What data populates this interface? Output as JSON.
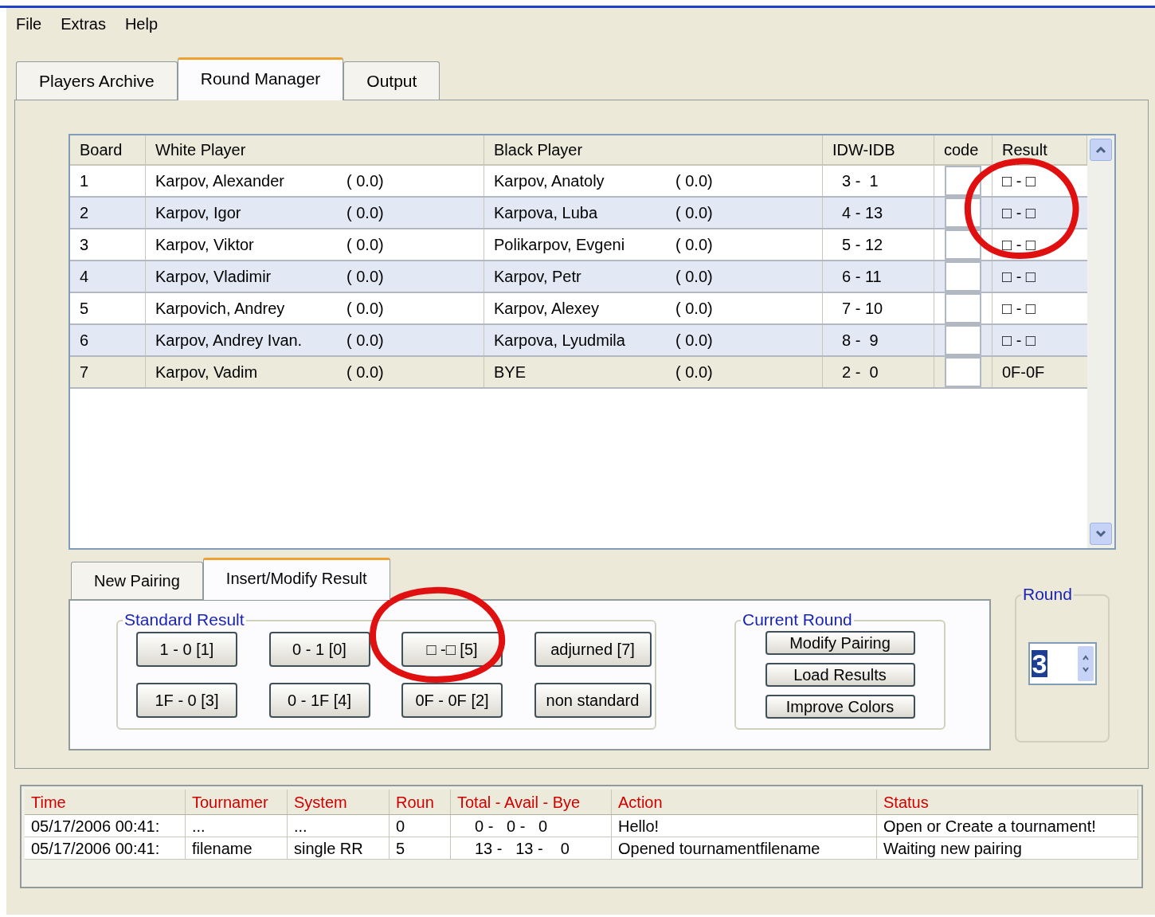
{
  "menu": [
    "File",
    "Extras",
    "Help"
  ],
  "tabs": [
    {
      "label": "Players Archive",
      "selected": false
    },
    {
      "label": "Round Manager",
      "selected": true
    },
    {
      "label": "Output",
      "selected": false
    }
  ],
  "pairings": {
    "columns": [
      "Board",
      "White Player",
      "Black Player",
      "IDW-IDB",
      "code",
      "Result"
    ],
    "rows": [
      {
        "board": "1",
        "white": "Karpov, Alexander",
        "white_score": "( 0.0)",
        "black": "Karpov, Anatoly",
        "black_score": "( 0.0)",
        "ids": "3 -  1",
        "result": "□ - □",
        "selected": false
      },
      {
        "board": "2",
        "white": "Karpov, Igor",
        "white_score": "( 0.0)",
        "black": "Karpova, Luba",
        "black_score": "( 0.0)",
        "ids": "4 - 13",
        "result": "□ - □",
        "selected": false
      },
      {
        "board": "3",
        "white": "Karpov, Viktor",
        "white_score": "( 0.0)",
        "black": "Polikarpov, Evgeni",
        "black_score": "( 0.0)",
        "ids": "5 - 12",
        "result": "□ - □",
        "selected": false
      },
      {
        "board": "4",
        "white": "Karpov, Vladimir",
        "white_score": "( 0.0)",
        "black": "Karpov, Petr",
        "black_score": "( 0.0)",
        "ids": "6 - 11",
        "result": "□ - □",
        "selected": false
      },
      {
        "board": "5",
        "white": "Karpovich, Andrey",
        "white_score": "( 0.0)",
        "black": "Karpov, Alexey",
        "black_score": "( 0.0)",
        "ids": "7 - 10",
        "result": "□ - □",
        "selected": false
      },
      {
        "board": "6",
        "white": "Karpov, Andrey Ivan.",
        "white_score": "( 0.0)",
        "black": "Karpova, Lyudmila",
        "black_score": "( 0.0)",
        "ids": "8 -  9",
        "result": "□ - □",
        "selected": false
      },
      {
        "board": "7",
        "white": "Karpov, Vadim",
        "white_score": "( 0.0)",
        "black": "BYE",
        "black_score": "( 0.0)",
        "ids": "2 -  0",
        "result": "0F-0F",
        "selected": true
      }
    ]
  },
  "sub_tabs": [
    {
      "label": "New Pairing",
      "selected": false
    },
    {
      "label": "Insert/Modify Result",
      "selected": true
    }
  ],
  "standard_result": {
    "title": "Standard Result",
    "buttons": [
      "1 - 0 [1]",
      "0 - 1 [0]",
      "□ -□ [5]",
      "adjurned [7]",
      "1F - 0 [3]",
      "0 - 1F [4]",
      "0F - 0F [2]",
      "non standard"
    ]
  },
  "current_round": {
    "title": "Current Round",
    "buttons": [
      "Modify Pairing",
      "Load Results",
      "Improve Colors"
    ]
  },
  "round": {
    "title": "Round",
    "value": "3"
  },
  "log": {
    "columns": [
      "Time",
      "Tournamer",
      "System",
      "Roun",
      "Total - Avail - Bye",
      "Action",
      "Status"
    ],
    "rows": [
      [
        "05/17/2006 00:41:",
        "...",
        "...",
        "0",
        "0 -   0 -   0",
        "Hello!",
        "Open or Create a tournament!"
      ],
      [
        "05/17/2006 00:41:",
        "filename",
        "single RR",
        "5",
        "13 -   13 -    0",
        "Opened tournamentfilename",
        "Waiting new pairing"
      ]
    ]
  }
}
